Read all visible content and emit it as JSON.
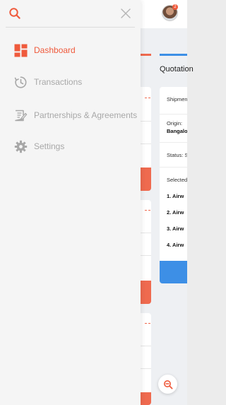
{
  "colors": {
    "accent": "#ef5a3c",
    "primary_blue": "#3d8fe6",
    "muted_text": "#a8a8a8"
  },
  "drawer": {
    "search_icon": "search-icon",
    "close_icon": "close-icon",
    "nav": [
      {
        "label": "Dashboard",
        "icon": "dashboard-icon",
        "active": true
      },
      {
        "label": "Transactions",
        "icon": "transactions-icon",
        "active": false
      },
      {
        "label": "Partnerships & Agreements",
        "icon": "agreements-icon",
        "active": false
      },
      {
        "label": "Settings",
        "icon": "gear-icon",
        "active": false
      }
    ]
  },
  "header": {
    "notification_count": "2"
  },
  "quotation": {
    "tab_label": "Quotation",
    "shipment_label": "Shipment",
    "origin_label": "Origin:",
    "origin_value": "Bangalo",
    "status_label": "Status: S",
    "selected_label": "Selected",
    "items": [
      "1. Airw",
      "2. Airw",
      "3. Airw",
      "4. Airw"
    ]
  }
}
